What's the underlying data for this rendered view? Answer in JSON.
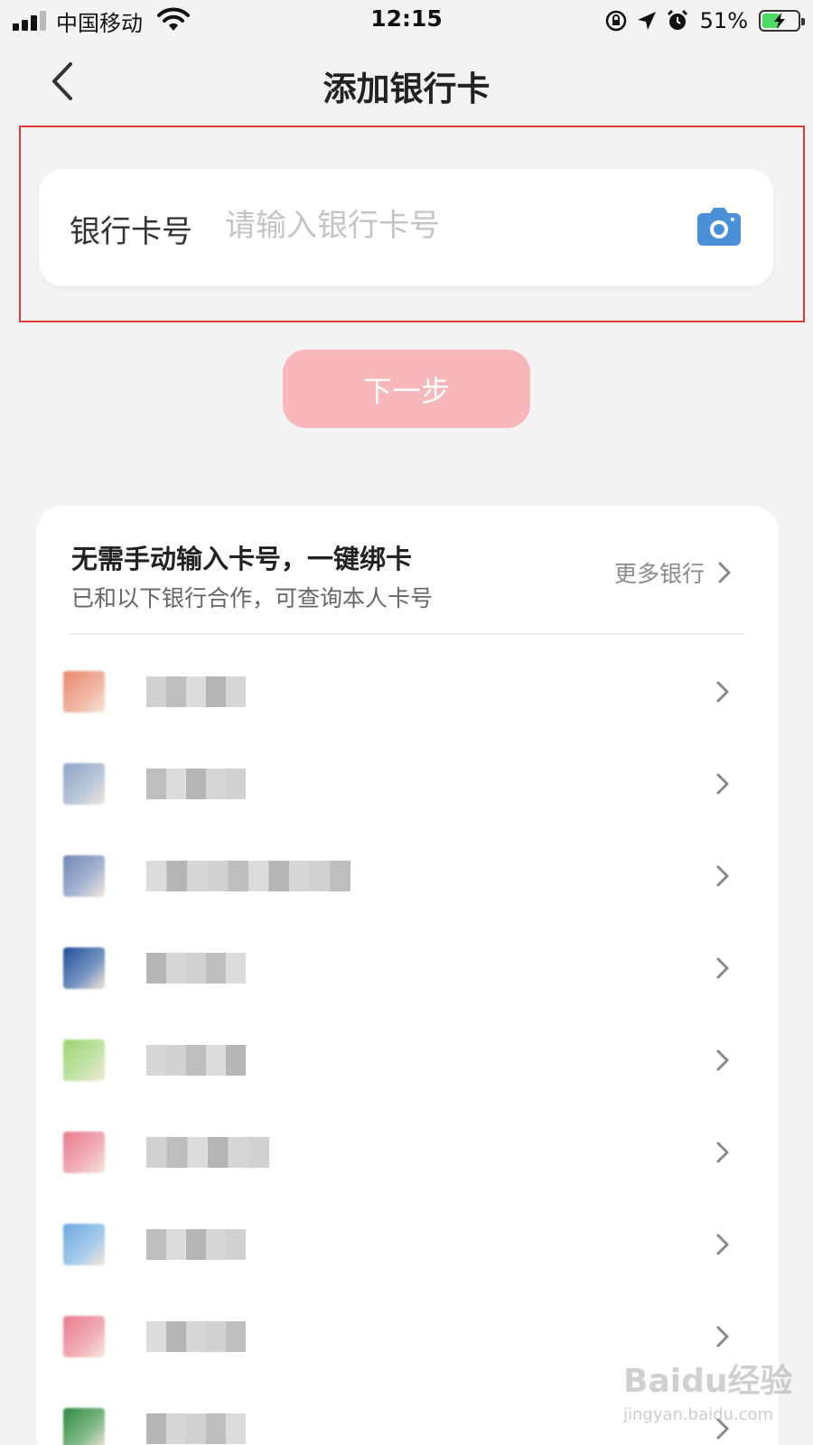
{
  "status_bar": {
    "carrier": "中国移动",
    "time": "12:15",
    "battery_percent": "51%",
    "battery_level": 0.51,
    "icons": [
      "signal-icon",
      "wifi-icon",
      "rotation-lock-icon",
      "location-icon",
      "alarm-icon",
      "battery-icon"
    ]
  },
  "nav": {
    "back_icon": "back-arrow-icon",
    "title": "添加银行卡"
  },
  "card_input": {
    "label": "银行卡号",
    "placeholder": "请输入银行卡号",
    "value": "",
    "scan_icon": "camera-icon"
  },
  "next_button": {
    "label": "下一步",
    "color": "#f8b7bb"
  },
  "bank_section": {
    "title": "无需手动输入卡号，一键绑卡",
    "subtitle": "已和以下银行合作，可查询本人卡号",
    "more_label": "更多银行",
    "banks": [
      {
        "name_obscured": true,
        "logo_color": "#e8886a"
      },
      {
        "name_obscured": true,
        "logo_color": "#8ea3c4"
      },
      {
        "name_obscured": true,
        "logo_color": "#6f86b6"
      },
      {
        "name_obscured": true,
        "logo_color": "#1f4f9a"
      },
      {
        "name_obscured": true,
        "logo_color": "#9bd36f"
      },
      {
        "name_obscured": true,
        "logo_color": "#e97a8a"
      },
      {
        "name_obscured": true,
        "logo_color": "#6aa9e0"
      },
      {
        "name_obscured": true,
        "logo_color": "#e97a8a"
      },
      {
        "name_obscured": true,
        "logo_color": "#2e8b3d"
      }
    ]
  },
  "watermark": {
    "brand": "Baidu经验",
    "url": "jingyan.baidu.com"
  },
  "colors": {
    "background": "#f4f3f4",
    "highlight_border": "#e03a3a",
    "camera_icon": "#4a90d9"
  }
}
